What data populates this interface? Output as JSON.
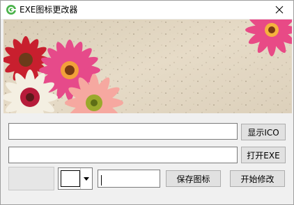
{
  "window": {
    "title": "EXE图标更改器",
    "app_icon": "green-swirl-icon",
    "close_icon": "close-icon"
  },
  "banner": {
    "description_icon": "flower-banner-image"
  },
  "row1": {
    "path_value": "",
    "button_label": "显示ICO"
  },
  "row2": {
    "path_value": "",
    "button_label": "打开EXE"
  },
  "row3": {
    "color_selected": "#ffffff",
    "name_value": "",
    "save_label": "保存图标",
    "start_label": "开始修改"
  },
  "colors": {
    "titlebar": "#ffffff",
    "window_bg": "#f0f0f0",
    "button_bg": "#e1e1e1",
    "app_icon_green": "#3aa53a"
  }
}
